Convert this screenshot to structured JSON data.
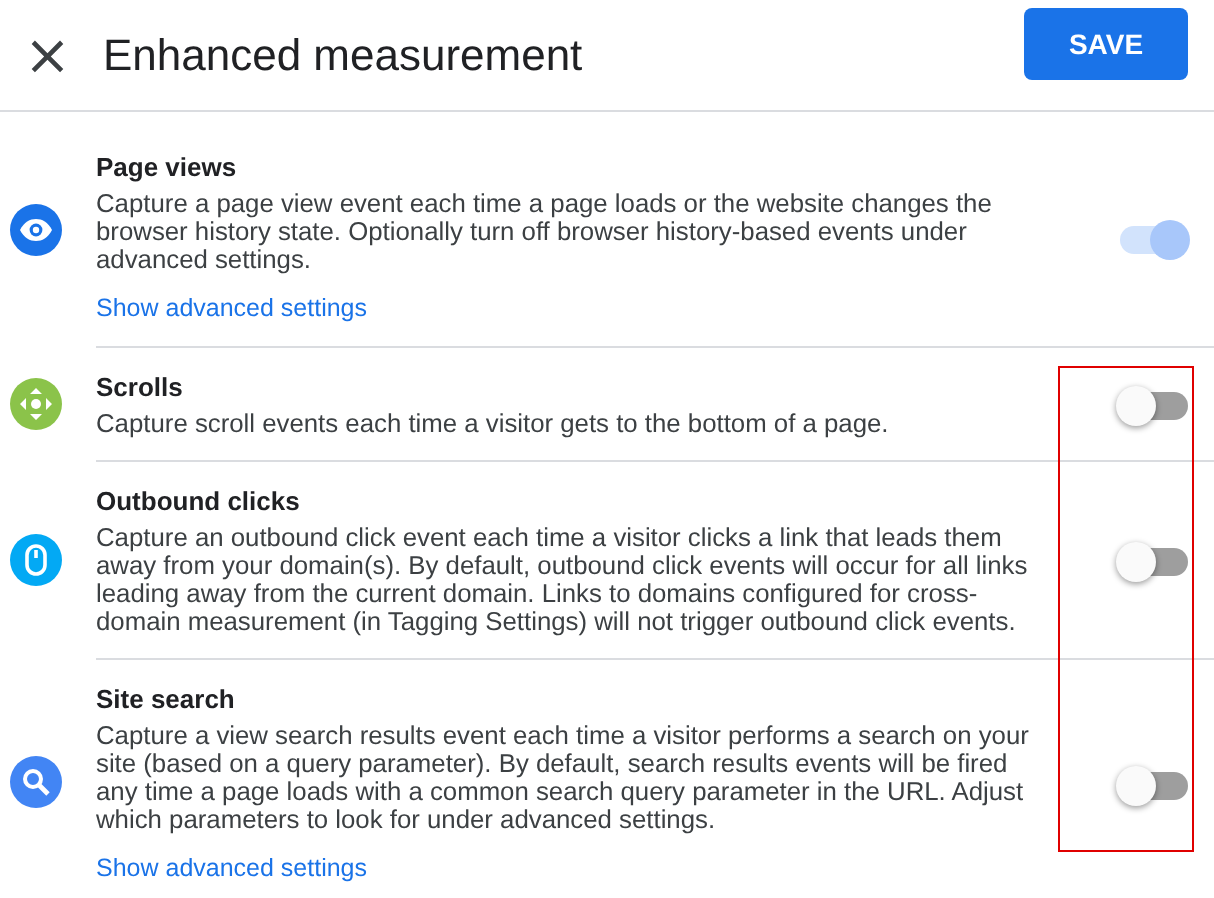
{
  "highlight_frame": true,
  "header": {
    "close": "×",
    "title": "Enhanced measurement",
    "save": "SAVE"
  },
  "settings": [
    {
      "kind": "eye",
      "title": "Page views",
      "description": "Capture a page view event each time a page loads or the website changes the browser history state. Optionally turn off browser history-based events under advanced settings.",
      "on": true,
      "disabled": true,
      "link": "Show advanced settings",
      "color": "#1a73e8"
    },
    {
      "kind": "scroll",
      "title": "Scrolls",
      "description": "Capture scroll events each time a visitor gets to the bottom of a page.",
      "on": false,
      "disabled": false,
      "color": "#8bc34a"
    },
    {
      "kind": "mouse",
      "title": "Outbound clicks",
      "description": "Capture an outbound click event each time a visitor clicks a link that leads them away from your domain(s). By default, outbound click events will occur for all links leading away from the current domain. Links to domains configured for cross-domain measurement (in Tagging Settings) will not trigger outbound click events.",
      "on": false,
      "disabled": false,
      "color": "#03a9f4"
    },
    {
      "kind": "search",
      "title": "Site search",
      "description": "Capture a view search results event each time a visitor performs a search on your site (based on a query parameter). By default, search results events will be fired any time a page loads with a common search query parameter in the URL. Adjust which parameters to look for under advanced settings.",
      "on": false,
      "disabled": false,
      "link": "Show advanced settings",
      "color": "#4285f4"
    }
  ]
}
